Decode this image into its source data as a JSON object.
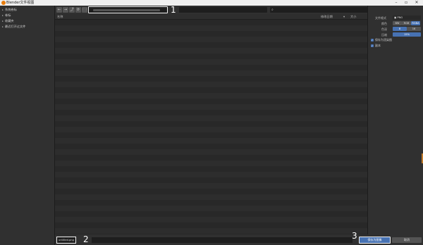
{
  "window": {
    "title": "Blender文件视图",
    "minimize_icon": "minimize-icon",
    "maximize_icon": "maximize-icon",
    "close_icon": "close-icon"
  },
  "sidebar": {
    "items": [
      {
        "label": "系统卷标"
      },
      {
        "label": "卷标"
      },
      {
        "label": "收藏夹"
      },
      {
        "label": "最近打开过文件"
      }
    ]
  },
  "toolbar": {
    "back_glyph": "←",
    "forward_glyph": "→",
    "parent_glyph": "⤴",
    "refresh_glyph": "⟳",
    "new_folder_glyph": "🗀",
    "search_glyph": "⌕",
    "view_icons": [
      "list-view-icon",
      "thumbnail-view-icon",
      "sort-icon",
      "filter-icon",
      "settings-icon"
    ]
  },
  "annotations": {
    "one": "1",
    "two": "2",
    "three": "3"
  },
  "file_list": {
    "headers": {
      "name": "名称",
      "modified": "修改日期",
      "size": "大小"
    },
    "sort_glyph": "▾"
  },
  "properties": {
    "format_label": "文件格式",
    "format_value": "PNG",
    "color_label": "颜色",
    "color_options": [
      "BW",
      "RGB",
      "RGBA"
    ],
    "depth_label": "色深",
    "depth_options": [
      "8",
      "16"
    ],
    "compression_label": "压缩",
    "compression_value": "15%",
    "save_as_render_label": "保存为渲染图",
    "copy_label": "副本"
  },
  "footer": {
    "filename_value": "untitled.png",
    "confirm_label": "保存为图像",
    "cancel_label": "取消"
  },
  "colors": {
    "accent": "#4772b3",
    "highlight": "#f2f2f2"
  }
}
